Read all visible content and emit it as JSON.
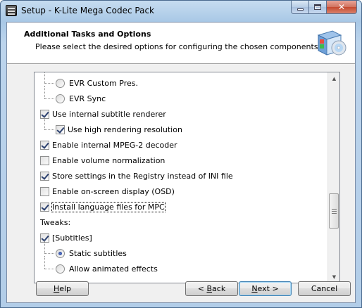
{
  "window": {
    "title": "Setup - K-Lite Mega Codec Pack"
  },
  "header": {
    "title": "Additional Tasks and Options",
    "subtitle": "Please select the desired options for configuring the chosen components."
  },
  "options": [
    {
      "kind": "radio",
      "label": "EVR Custom Pres.",
      "checked": false,
      "indent": 1
    },
    {
      "kind": "radio",
      "label": "EVR Sync",
      "checked": false,
      "indent": 1
    },
    {
      "kind": "checkbox",
      "label": "Use internal subtitle renderer",
      "checked": true,
      "indent": 0
    },
    {
      "kind": "checkbox",
      "label": "Use high rendering resolution",
      "checked": true,
      "indent": 1
    },
    {
      "kind": "checkbox",
      "label": "Enable internal MPEG-2 decoder",
      "checked": true,
      "indent": 0
    },
    {
      "kind": "checkbox",
      "label": "Enable volume normalization",
      "checked": false,
      "indent": 0
    },
    {
      "kind": "checkbox",
      "label": "Store settings in the Registry instead of INI file",
      "checked": true,
      "indent": 0
    },
    {
      "kind": "checkbox",
      "label": "Enable on-screen display (OSD)",
      "checked": false,
      "indent": 0
    },
    {
      "kind": "checkbox",
      "label": "Install language files for MPC",
      "checked": true,
      "indent": 0,
      "focused": true
    },
    {
      "kind": "text",
      "label": "Tweaks:",
      "indent": 0
    },
    {
      "kind": "checkbox",
      "label": "[Subtitles]",
      "checked": true,
      "indent": 0
    },
    {
      "kind": "radio",
      "label": "Static subtitles",
      "checked": true,
      "indent": 1
    },
    {
      "kind": "radio",
      "label": "Allow animated effects",
      "checked": false,
      "indent": 1
    }
  ],
  "scrollbar": {
    "position_fraction": 0.72,
    "thumb_fraction": 0.19
  },
  "buttons": {
    "help": {
      "prefix": "",
      "accel": "H",
      "suffix": "elp"
    },
    "back": {
      "prefix": "< ",
      "accel": "B",
      "suffix": "ack"
    },
    "next": {
      "prefix": "",
      "accel": "N",
      "suffix": "ext >"
    },
    "cancel": {
      "prefix": "Cancel",
      "accel": "",
      "suffix": ""
    }
  }
}
